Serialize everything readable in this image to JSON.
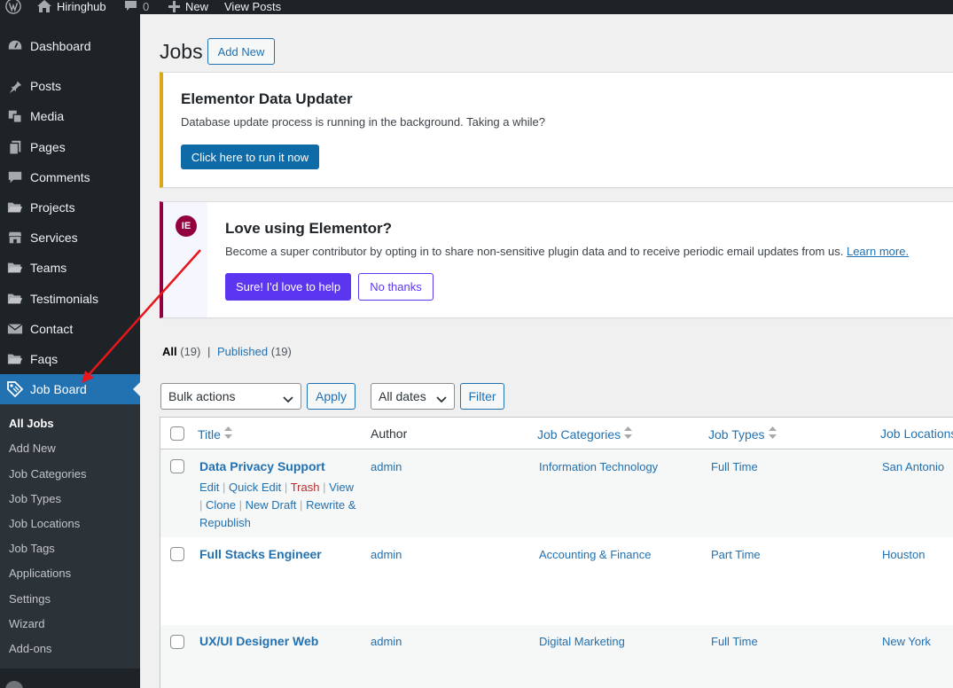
{
  "adminbar": {
    "site_name": "Hiringhub",
    "comments_count": "0",
    "new_label": "New",
    "view_posts_label": "View Posts"
  },
  "sidebar": {
    "items": [
      {
        "label": "Dashboard",
        "icon": "dashboard-icon"
      },
      {
        "label": "Posts",
        "icon": "pin-icon"
      },
      {
        "label": "Media",
        "icon": "media-icon"
      },
      {
        "label": "Pages",
        "icon": "pages-icon"
      },
      {
        "label": "Comments",
        "icon": "comment-icon"
      },
      {
        "label": "Projects",
        "icon": "folder-icon"
      },
      {
        "label": "Services",
        "icon": "store-icon"
      },
      {
        "label": "Teams",
        "icon": "folder-icon"
      },
      {
        "label": "Testimonials",
        "icon": "folder-icon"
      },
      {
        "label": "Contact",
        "icon": "mail-icon"
      },
      {
        "label": "Faqs",
        "icon": "folder-icon"
      },
      {
        "label": "Job Board",
        "icon": "tag-icon"
      }
    ],
    "submenu": [
      "All Jobs",
      "Add New",
      "Job Categories",
      "Job Types",
      "Job Locations",
      "Job Tags",
      "Applications",
      "Settings",
      "Wizard",
      "Add-ons"
    ]
  },
  "header": {
    "title": "Jobs",
    "add_new_label": "Add New"
  },
  "notice_updater": {
    "title": "Elementor Data Updater",
    "text": "Database update process is running in the background. Taking a while?",
    "button_label": "Click here to run it now"
  },
  "notice_love": {
    "logo_text": "IE",
    "title": "Love using Elementor?",
    "text": "Become a super contributor by opting in to share non-sensitive plugin data and to receive periodic email updates from us.",
    "learn_more": "Learn more.",
    "accept_label": "Sure! I'd love to help",
    "decline_label": "No thanks"
  },
  "filters": {
    "all_label": "All",
    "all_count": "(19)",
    "separator": "|",
    "published_label": "Published",
    "published_count": "(19)",
    "bulk_actions": "Bulk actions",
    "apply_label": "Apply",
    "dates": "All dates",
    "filter_label": "Filter"
  },
  "table": {
    "columns": [
      "Title",
      "Author",
      "Job Categories",
      "Job Types",
      "Job Locations"
    ],
    "row_actions": {
      "edit": "Edit",
      "quick_edit": "Quick Edit",
      "trash": "Trash",
      "view": "View",
      "clone": "Clone",
      "new_draft": "New Draft",
      "rewrite": "Rewrite",
      "republish": "& Republish",
      "sep": "|"
    },
    "rows": [
      {
        "title": "Data Privacy Support",
        "author": "admin",
        "category": "Information Technology",
        "type": "Full Time",
        "location": "San Antonio"
      },
      {
        "title": "Full Stacks Engineer",
        "author": "admin",
        "category": "Accounting & Finance",
        "type": "Part Time",
        "location": "Houston"
      },
      {
        "title": "UX/UI Designer Web",
        "author": "admin",
        "category": "Digital Marketing",
        "type": "Full Time",
        "location": "New York"
      }
    ]
  },
  "colors": {
    "admin_dark": "#1d2327",
    "accent": "#2271b1",
    "elementor": "#93003f",
    "purple": "#5c35f0",
    "warning": "#dba617",
    "arrow": "#e8161b"
  }
}
